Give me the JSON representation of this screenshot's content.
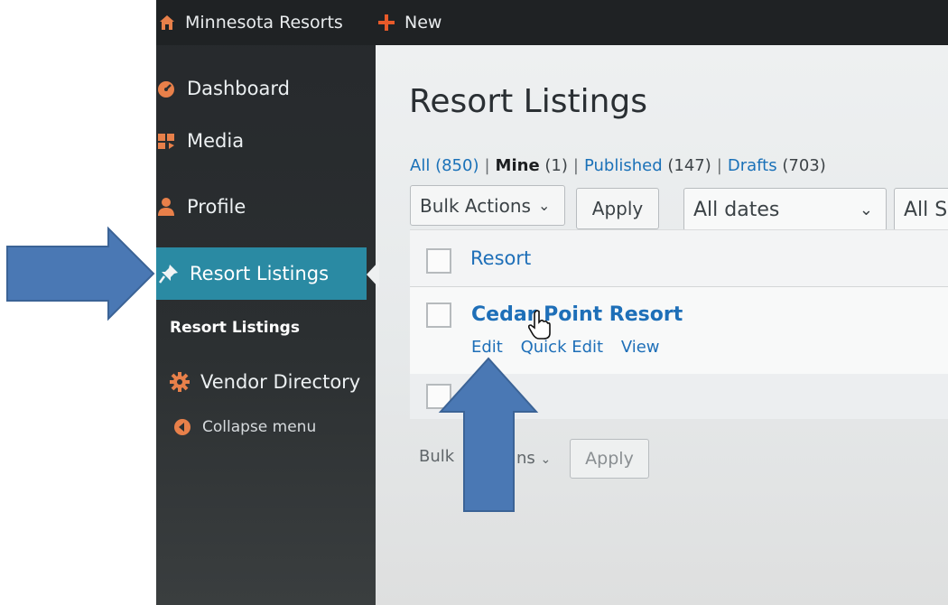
{
  "admin_bar": {
    "site_name": "Minnesota Resorts",
    "new_label": "New",
    "new_icon": "plus-icon"
  },
  "sidebar": {
    "items": [
      {
        "label": "Dashboard",
        "icon": "dashboard-icon"
      },
      {
        "label": "Media",
        "icon": "media-icon"
      },
      {
        "label": "Profile",
        "icon": "user-icon"
      },
      {
        "label": "Resort Listings",
        "icon": "pin-icon",
        "current": true
      },
      {
        "label": "Vendor Directory",
        "icon": "gear-icon"
      }
    ],
    "submenu_label": "Resort Listings",
    "collapse_label": "Collapse menu"
  },
  "page": {
    "title": "Resort Listings",
    "filters": {
      "all_label": "All",
      "all_count": "(850)",
      "mine_label": "Mine",
      "mine_count": "(1)",
      "published_label": "Published",
      "published_count": "(147)",
      "drafts_label": "Drafts",
      "drafts_count": "(703)",
      "separator": "|"
    },
    "toolbar": {
      "bulk_actions": "Bulk Actions",
      "apply": "Apply",
      "dates": "All dates",
      "categories_partial": "All S"
    },
    "table": {
      "column_header": "Resort",
      "rows": [
        {
          "title": "Cedar Point Resort",
          "actions": {
            "edit": "Edit",
            "quick_edit": "Quick Edit",
            "view": "View"
          }
        }
      ]
    },
    "footer_toolbar": {
      "bulk_actions_partial_1": "Bulk",
      "bulk_actions_partial_2": "ns",
      "apply": "Apply"
    }
  },
  "colors": {
    "sidebar_bg": "#2b2f31",
    "current_menu_bg": "#2a8aa3",
    "link": "#1e6fb8",
    "icon_orange": "#e8804a",
    "annotation_arrow": "#4a7ab5"
  }
}
